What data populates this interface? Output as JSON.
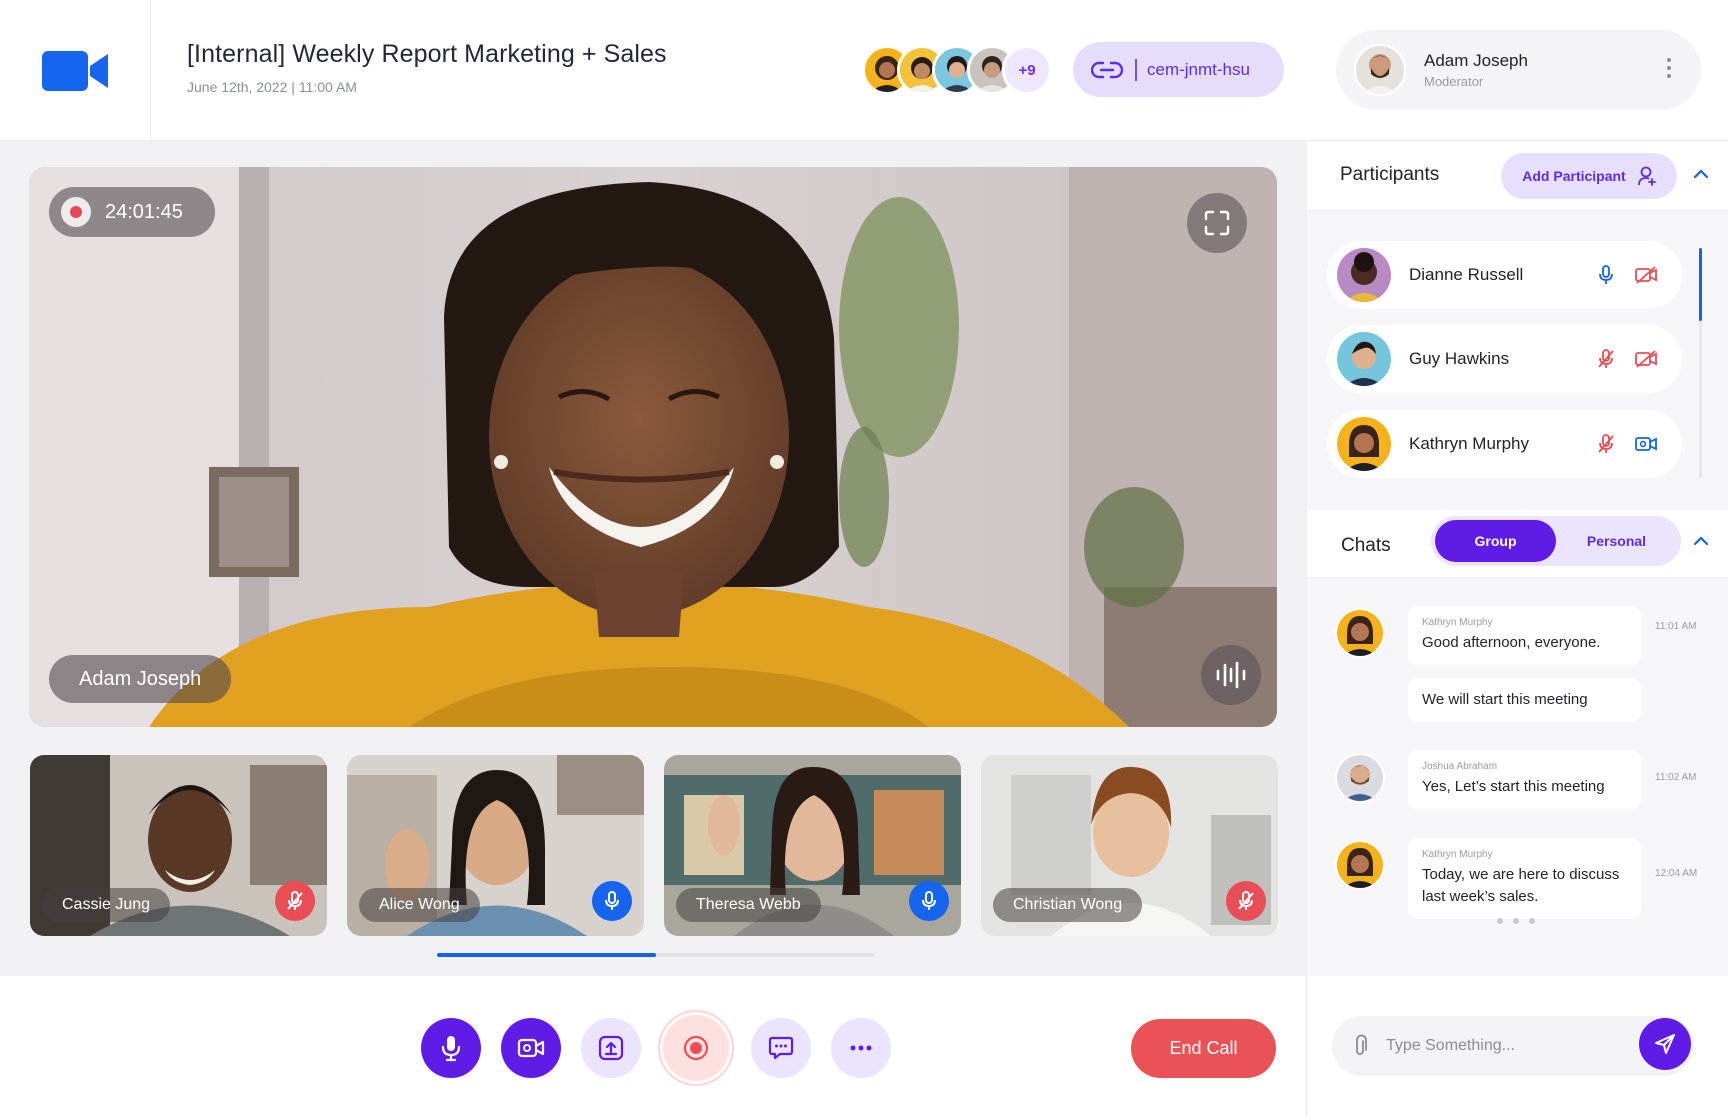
{
  "meeting": {
    "title": "[Internal] Weekly Report Marketing + Sales",
    "datetime": "June 12th, 2022 | 11:00 AM",
    "extra_participants": "+9",
    "meeting_code": "cem-jnmt-hsu"
  },
  "user": {
    "name": "Adam Joseph",
    "role": "Moderator"
  },
  "main_video": {
    "recording_time": "24:01:45",
    "speaker_name": "Adam Joseph"
  },
  "thumbnails": [
    {
      "name": "Cassie Jung",
      "mic": "muted"
    },
    {
      "name": "Alice Wong",
      "mic": "on"
    },
    {
      "name": "Theresa Webb",
      "mic": "on"
    },
    {
      "name": "Christian Wong",
      "mic": "muted"
    }
  ],
  "thumbnail_scroll_progress": 0.5,
  "participants": {
    "title": "Participants",
    "add_label": "Add Participant",
    "list": [
      {
        "name": "Dianne Russell",
        "mic": "on",
        "camera": "off"
      },
      {
        "name": "Guy Hawkins",
        "mic": "off",
        "camera": "off"
      },
      {
        "name": "Kathryn Murphy",
        "mic": "off",
        "camera": "on"
      }
    ]
  },
  "chats": {
    "title": "Chats",
    "tabs": [
      "Group",
      "Personal"
    ],
    "active_tab": "Group",
    "messages": [
      {
        "sender": "Kathryn Murphy",
        "text": "Good afternoon, everyone.",
        "time": "11:01 AM"
      },
      {
        "sender": "",
        "text": "We will start this meeting",
        "time": ""
      },
      {
        "sender": "Joshua Abraham",
        "text": "Yes, Let’s start this meeting",
        "time": "11:02 AM"
      },
      {
        "sender": "Kathryn Murphy",
        "text": "Today, we are here to discuss last week’s sales.",
        "time": "12:04 AM"
      }
    ],
    "input_placeholder": "Type Something..."
  },
  "controls": {
    "end_call_label": "End Call",
    "buttons": [
      "microphone",
      "camera",
      "share-screen",
      "record",
      "chat",
      "more"
    ]
  },
  "colors": {
    "brand": "#1565f0",
    "accent": "#5f1ce6",
    "danger": "#ea5355"
  }
}
